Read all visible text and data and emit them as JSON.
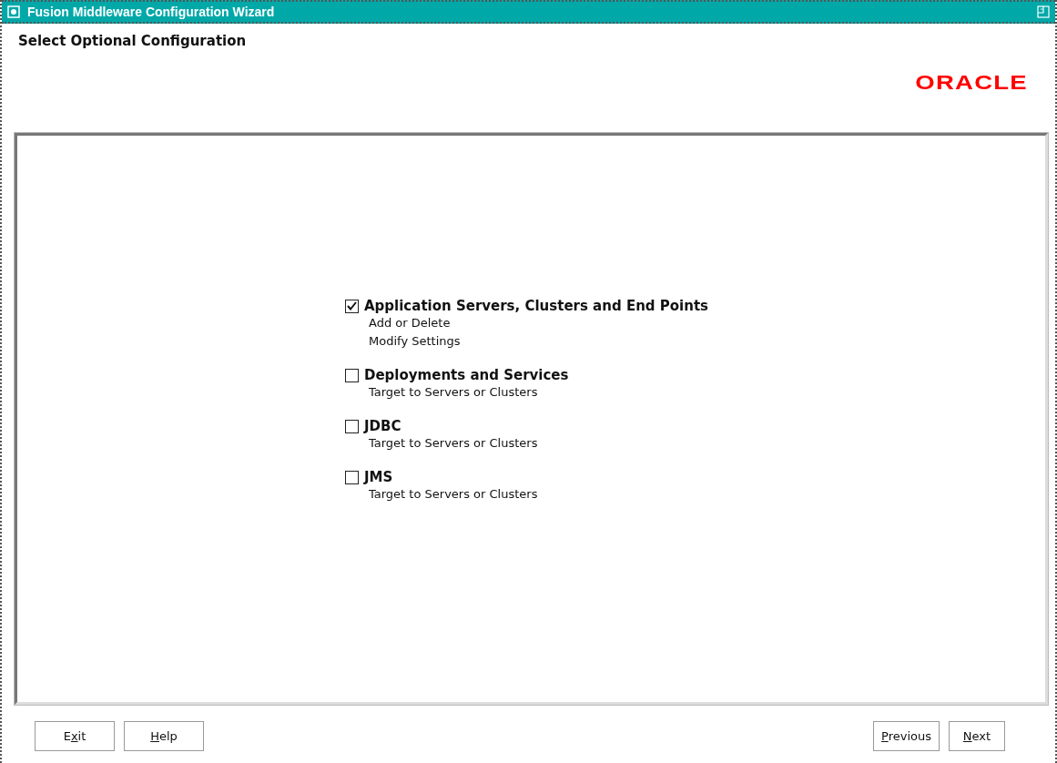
{
  "window": {
    "title": "Fusion Middleware Configuration Wizard"
  },
  "header": {
    "title": "Select Optional Configuration",
    "logo": "ORACLE"
  },
  "options": [
    {
      "label": "Application Servers, Clusters and End Points",
      "checked": true,
      "details": [
        "Add or Delete",
        "Modify Settings"
      ]
    },
    {
      "label": "Deployments and Services",
      "checked": false,
      "details": [
        "Target to Servers or Clusters"
      ]
    },
    {
      "label": "JDBC",
      "checked": false,
      "details": [
        "Target to Servers or Clusters"
      ]
    },
    {
      "label": "JMS",
      "checked": false,
      "details": [
        "Target to Servers or Clusters"
      ]
    }
  ],
  "left_buttons": [
    {
      "before": "E",
      "key": "x",
      "after": "it"
    },
    {
      "key": "H",
      "after": "elp"
    }
  ],
  "right_buttons": [
    {
      "key": "P",
      "after": "revious"
    },
    {
      "key": "N",
      "after": "ext"
    }
  ]
}
